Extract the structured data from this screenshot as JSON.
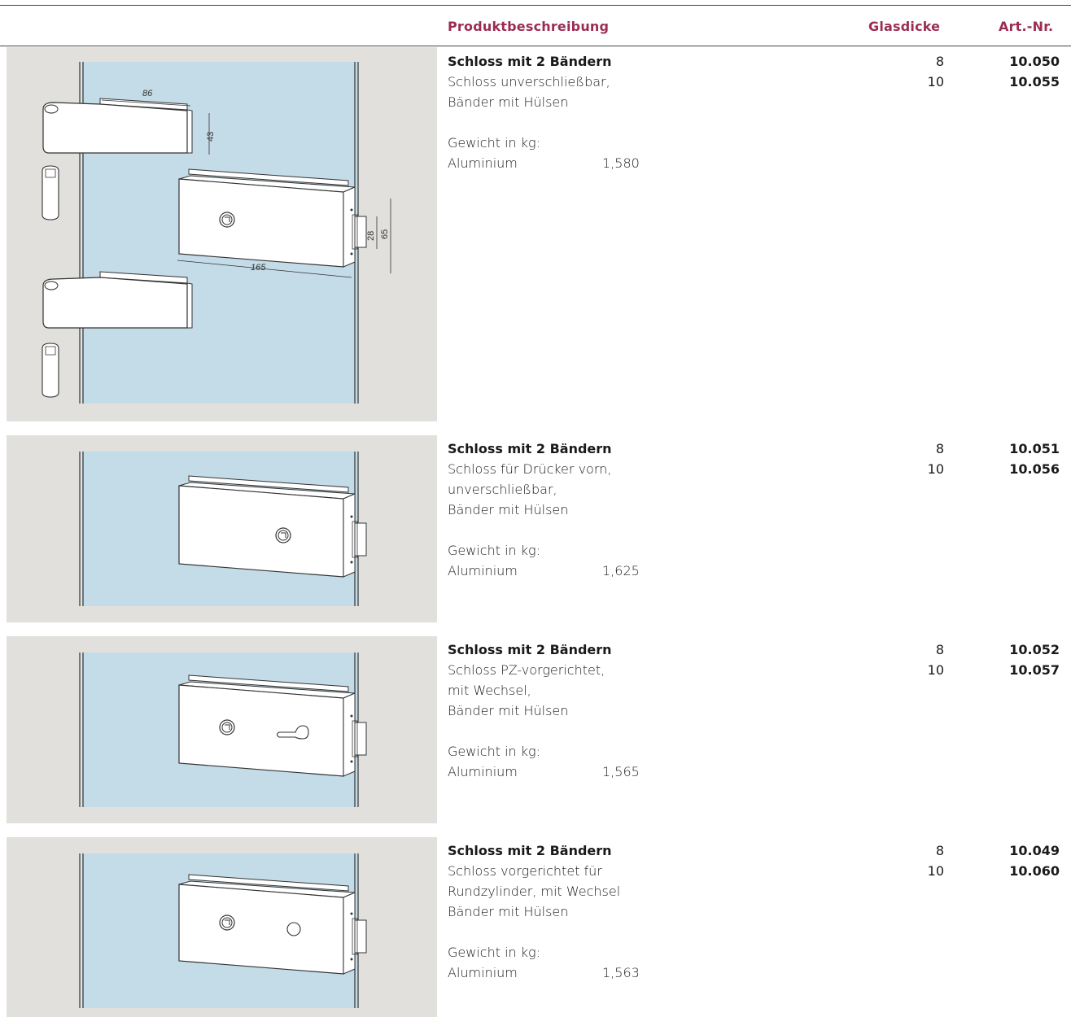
{
  "header": {
    "produktbeschreibung": "Produktbeschreibung",
    "glasdicke": "Glasdicke",
    "art_nr": "Art.-Nr."
  },
  "products": [
    {
      "title": "Schloss mit 2 Bändern",
      "lines": [
        "Schloss unverschließbar,",
        "Bänder mit Hülsen"
      ],
      "weight_label": "Gewicht in kg:",
      "material": "Aluminium",
      "weight": "1,580",
      "glass": [
        "8",
        "10"
      ],
      "art": [
        "10.050",
        "10.055"
      ],
      "dimensions": [
        "86",
        "43",
        "165",
        "28",
        "65"
      ]
    },
    {
      "title": "Schloss mit 2 Bändern",
      "lines": [
        "Schloss für Drücker vorn,",
        "unverschließbar,",
        "Bänder mit Hülsen"
      ],
      "weight_label": "Gewicht in kg:",
      "material": "Aluminium",
      "weight": "1,625",
      "glass": [
        "8",
        "10"
      ],
      "art": [
        "10.051",
        "10.056"
      ]
    },
    {
      "title": "Schloss mit 2 Bändern",
      "lines": [
        "Schloss PZ-vorgerichtet,",
        "mit Wechsel,",
        "Bänder mit Hülsen"
      ],
      "weight_label": "Gewicht in kg:",
      "material": "Aluminium",
      "weight": "1,565",
      "glass": [
        "8",
        "10"
      ],
      "art": [
        "10.052",
        "10.057"
      ]
    },
    {
      "title": "Schloss mit 2 Bändern",
      "lines": [
        "Schloss vorgerichtet für",
        "Rundzylinder, mit Wechsel",
        "Bänder mit Hülsen"
      ],
      "weight_label": "Gewicht in kg:",
      "material": "Aluminium",
      "weight": "1,563",
      "glass": [
        "8",
        "10"
      ],
      "art": [
        "10.049",
        "10.060"
      ]
    }
  ],
  "colors": {
    "accent": "#9b2d55",
    "panel_bg": "#e1e0dc",
    "glass": "#c4dce8"
  }
}
